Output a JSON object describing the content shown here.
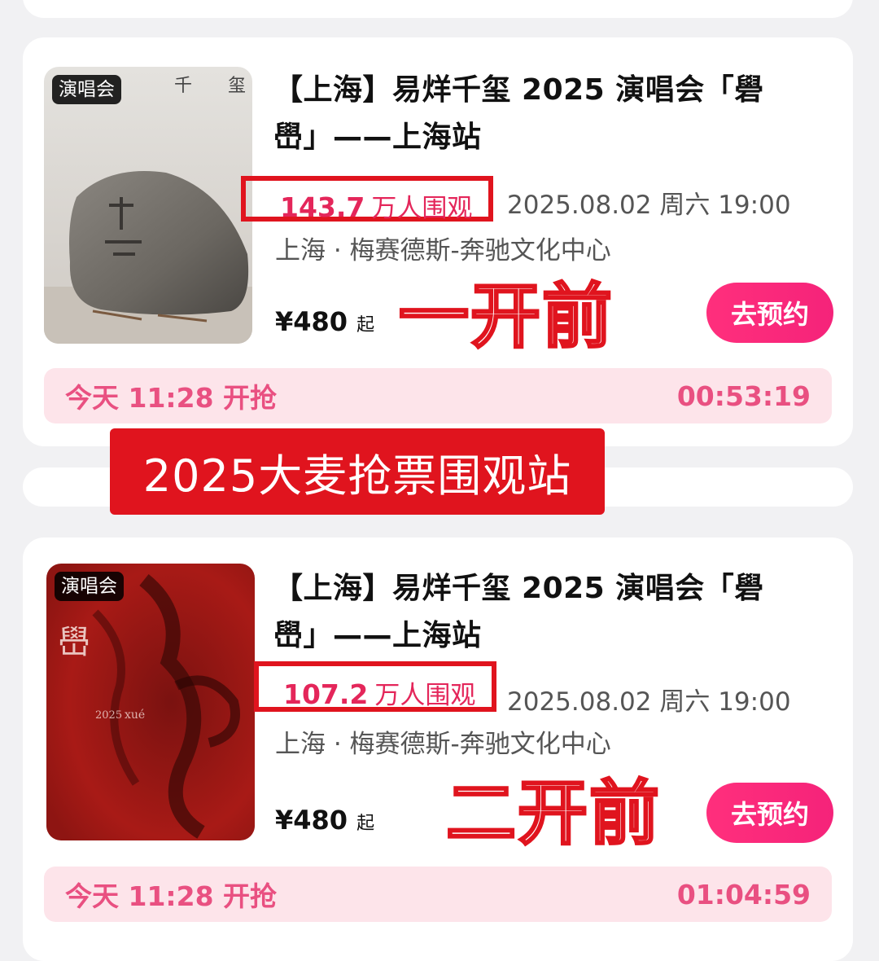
{
  "cards": [
    {
      "badge": "演唱会",
      "title": "【上海】易烊千玺 2025 演唱会「礐 嶨」——上海站",
      "views_number": "143.7",
      "views_unit": "万人围观",
      "datetime": "2025.08.02 周六 19:00",
      "venue": "上海 · 梅赛德斯-奔驰文化中心",
      "price": "¥480",
      "price_suffix": "起",
      "annotation": "一开前",
      "button": "去预约",
      "sale_label": "今天 11:28 开抢",
      "countdown": "00:53:19"
    },
    {
      "badge": "演唱会",
      "title": "【上海】易烊千玺 2025 演唱会「礐 嶨」——上海站",
      "views_number": "107.2",
      "views_unit": "万人围观",
      "datetime": "2025.08.02 周六 19:00",
      "venue": "上海 · 梅赛德斯-奔驰文化中心",
      "price": "¥480",
      "price_suffix": "起",
      "annotation": "二开前",
      "button": "去预约",
      "sale_label": "今天 11:28 开抢",
      "countdown": "01:04:59"
    }
  ],
  "watermark": "2025大麦抢票围观站",
  "colors": {
    "accent_pink": "#e4265a",
    "button_pink": "#ff2f7c",
    "countdown_bg": "#fde4ea",
    "annotation_red": "#e0141e"
  }
}
